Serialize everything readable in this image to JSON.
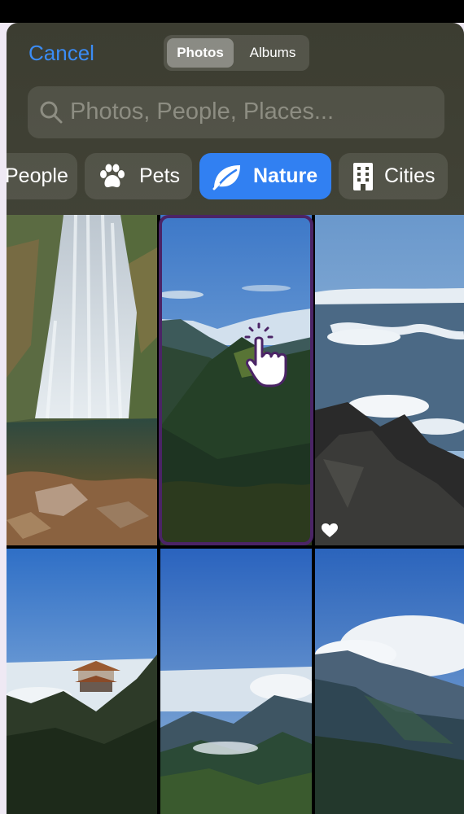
{
  "header": {
    "cancel_label": "Cancel",
    "segments": [
      "Photos",
      "Albums"
    ],
    "active_segment": "Photos"
  },
  "search": {
    "placeholder": "Photos, People, Places..."
  },
  "categories": [
    {
      "label": "People",
      "icon": "person-icon"
    },
    {
      "label": "Pets",
      "icon": "paw-icon"
    },
    {
      "label": "Nature",
      "icon": "leaf-icon",
      "active": true
    },
    {
      "label": "Cities",
      "icon": "building-icon"
    }
  ],
  "photos": [
    {
      "subject": "waterfall"
    },
    {
      "subject": "mountain-valley",
      "selected": true
    },
    {
      "subject": "sea-of-clouds",
      "favorite": true
    },
    {
      "subject": "pagoda-on-cliff"
    },
    {
      "subject": "clouds-over-ridges"
    },
    {
      "subject": "cloudy-mountainside"
    }
  ],
  "colors": {
    "accent": "#3180f2",
    "cancel": "#3b8cf5",
    "selection_border": "#4b2466"
  }
}
